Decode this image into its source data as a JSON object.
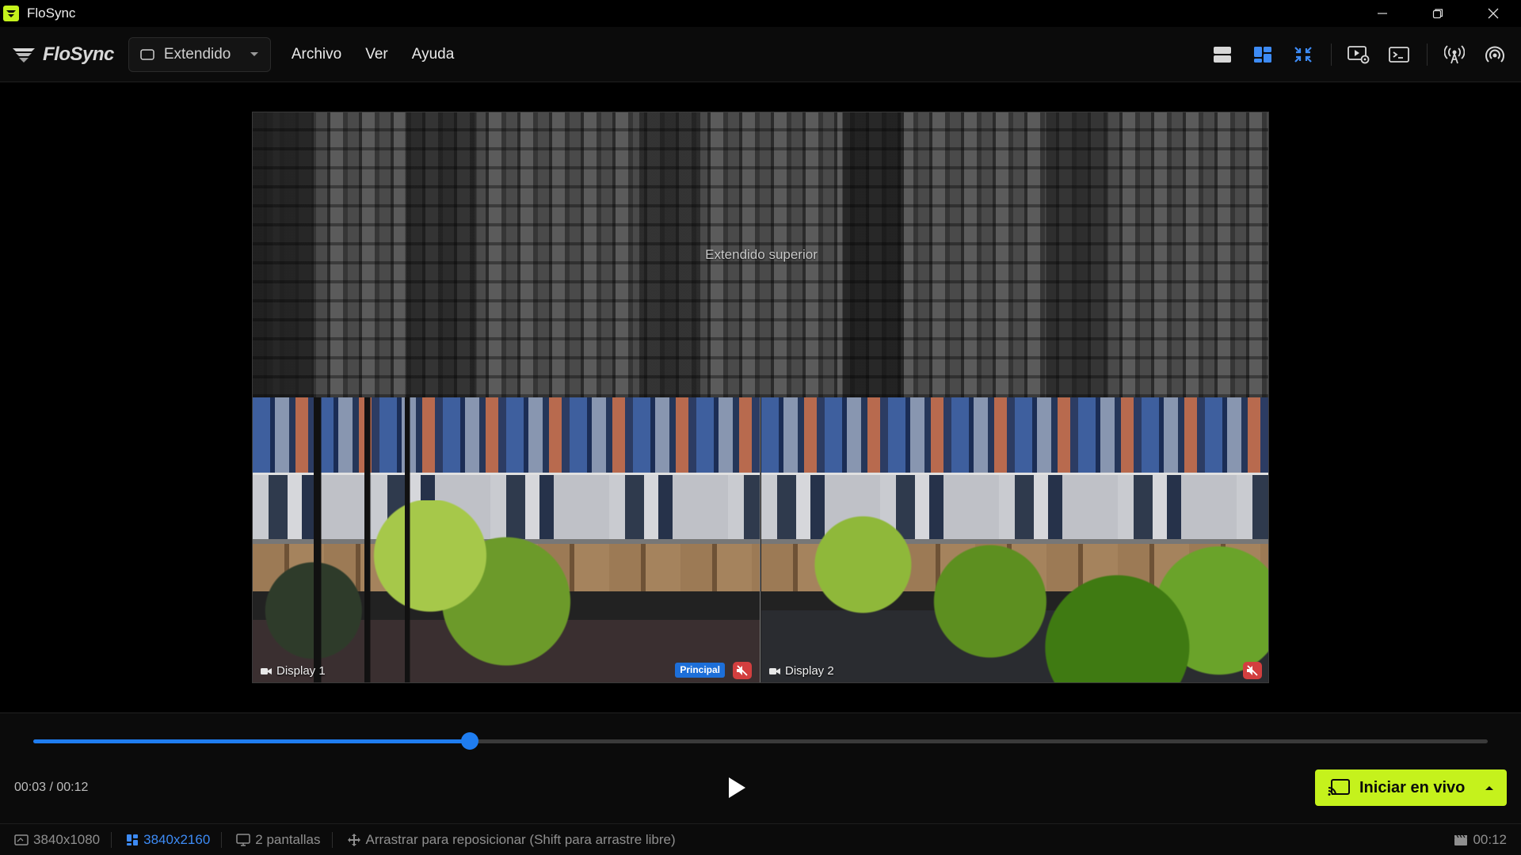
{
  "window": {
    "title": "FloSync",
    "brand_color": "#c5f21c"
  },
  "menubar": {
    "brand_text": "FloSync",
    "mode": "Extendido",
    "menus": [
      "Archivo",
      "Ver",
      "Ayuda"
    ],
    "tools": [
      {
        "icon": "rows-layout-icon"
      },
      {
        "icon": "grid-layout-icon",
        "active": true
      },
      {
        "icon": "collapse-icon",
        "active": true
      },
      {
        "icon": "media-settings-icon"
      },
      {
        "icon": "terminal-icon"
      },
      {
        "icon": "broadcast-tower-icon"
      },
      {
        "icon": "wireless-signal-icon"
      }
    ],
    "active_color": "#3d8bf5"
  },
  "preview": {
    "upper_label": "Extendido superior",
    "displays": [
      {
        "label": "Display 1",
        "badge": "Principal",
        "muted": true
      },
      {
        "label": "Display 2",
        "muted": true
      }
    ]
  },
  "player": {
    "time_readout": "00:03 / 00:12",
    "progress_fraction": 0.3,
    "live_button": "Iniciar en vivo",
    "accent_color": "#1f7df0"
  },
  "statusbar": {
    "canvas_size": "3840x1080",
    "output_size": "3840x2160",
    "screens": "2 pantallas",
    "hint": "Arrastrar para reposicionar (Shift para arrastre libre)",
    "duration": "00:12"
  }
}
